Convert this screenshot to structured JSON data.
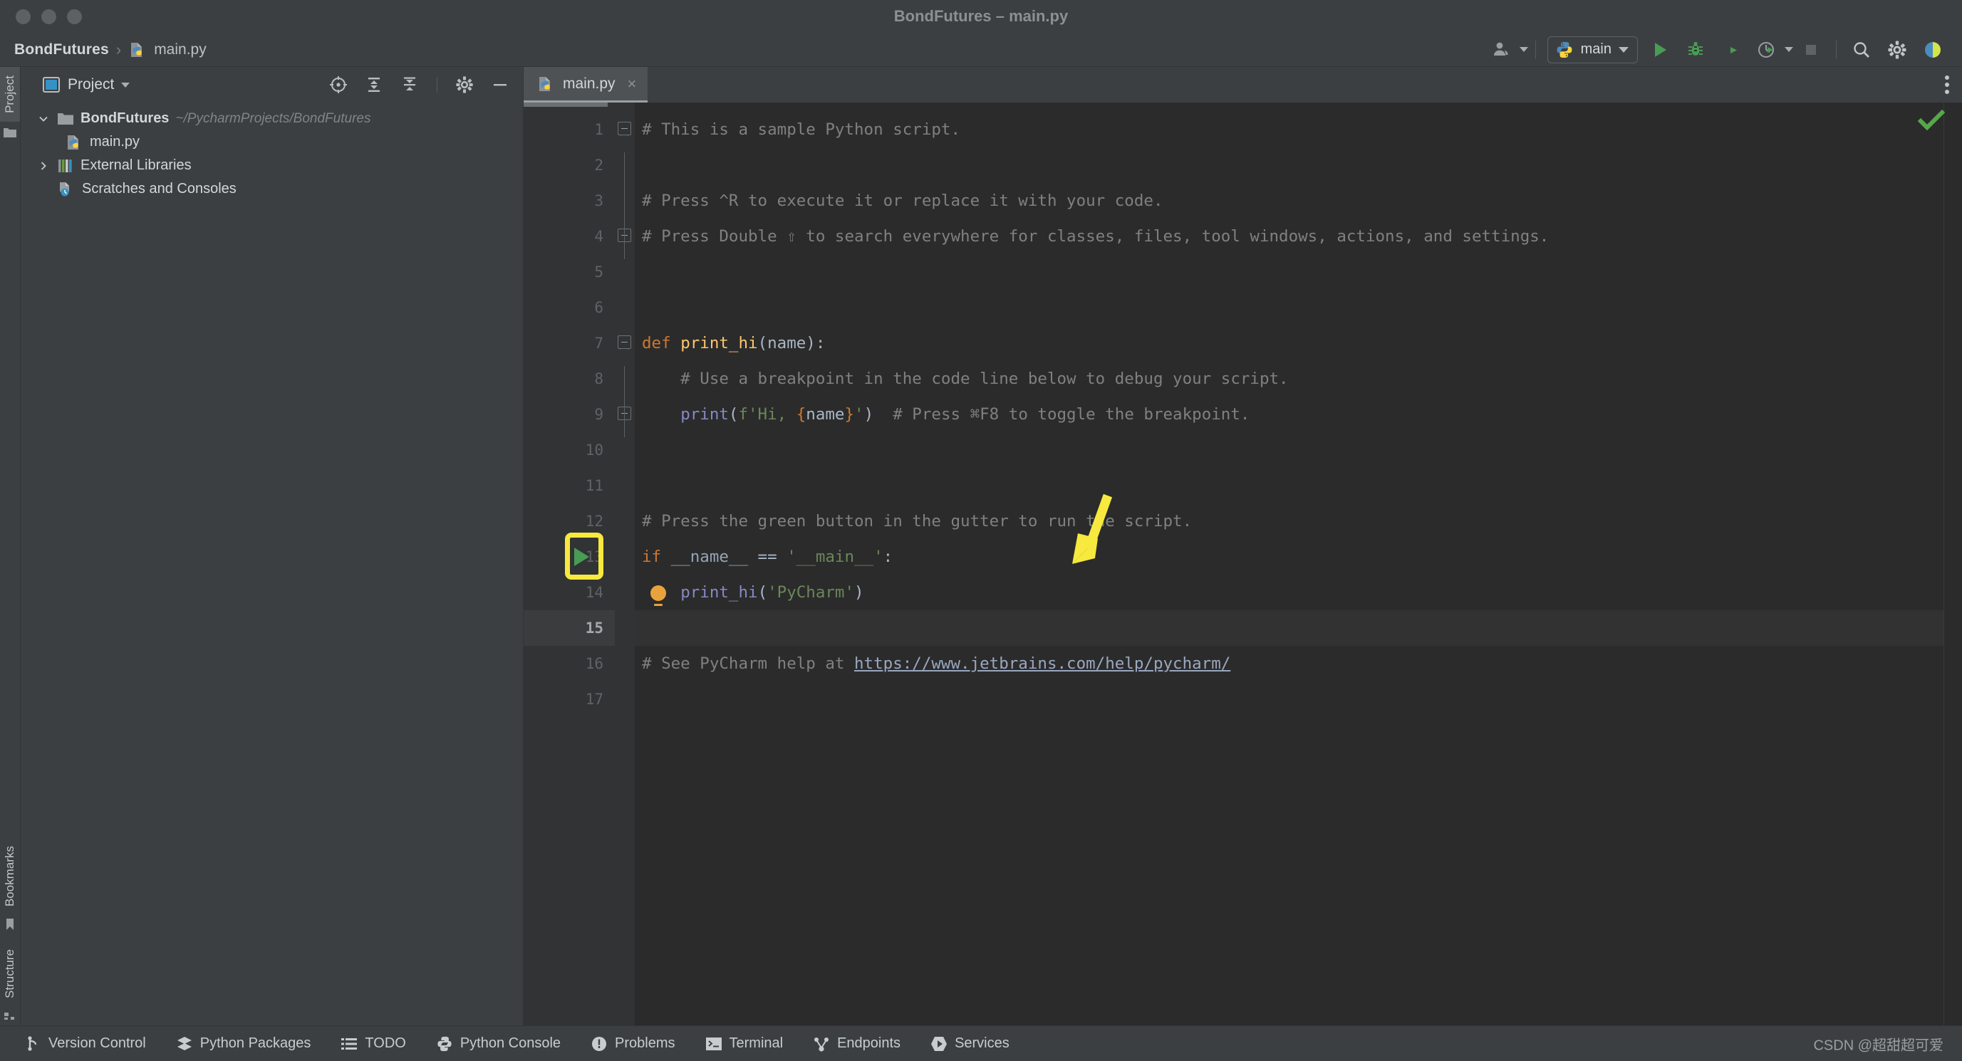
{
  "window": {
    "title": "BondFutures – main.py",
    "traffic_lights": [
      "close",
      "minimize",
      "zoom"
    ]
  },
  "toolbar": {
    "breadcrumb": {
      "project": "BondFutures",
      "separator": "›",
      "file": "main.py"
    },
    "account_icon": "user-account-icon",
    "run_config": {
      "label": "main",
      "icon": "python-icon"
    },
    "actions": [
      {
        "name": "run-button",
        "icon": "play-icon",
        "color": "#499c54"
      },
      {
        "name": "debug-button",
        "icon": "bug-icon",
        "color": "#499c54"
      },
      {
        "name": "run-with-coverage-button",
        "icon": "coverage-icon"
      },
      {
        "name": "profile-button",
        "icon": "profiler-icon"
      },
      {
        "name": "stop-button",
        "icon": "stop-icon"
      },
      {
        "name": "search-everywhere-button",
        "icon": "search-icon"
      },
      {
        "name": "settings-button",
        "icon": "gear-icon"
      }
    ]
  },
  "left_strip": {
    "tabs": [
      {
        "label": "Project",
        "icon": "folder-icon",
        "selected": true
      },
      {
        "label": "Bookmarks",
        "icon": "bookmark-icon",
        "selected": false
      },
      {
        "label": "Structure",
        "icon": "structure-icon",
        "selected": false
      }
    ]
  },
  "project_panel": {
    "title": "Project",
    "header_icons": [
      "locate-target-icon",
      "expand-all-icon",
      "collapse-all-icon",
      "gear-icon",
      "minimize-icon"
    ],
    "tree": [
      {
        "label": "BondFutures",
        "path": "~/PycharmProjects/BondFutures",
        "icon": "folder-icon",
        "expanded": true,
        "depth": 0,
        "bold": true
      },
      {
        "label": "main.py",
        "path": "",
        "icon": "python-file-icon",
        "expanded": null,
        "depth": 1,
        "bold": false
      },
      {
        "label": "External Libraries",
        "path": "",
        "icon": "libraries-icon",
        "expanded": false,
        "depth": 0,
        "bold": false
      },
      {
        "label": "Scratches and Consoles",
        "path": "",
        "icon": "scratches-icon",
        "expanded": null,
        "depth": 0,
        "bold": false
      }
    ]
  },
  "editor": {
    "tabs": [
      {
        "label": "main.py",
        "icon": "python-file-icon",
        "close": "×",
        "active": true
      }
    ],
    "inspection_status": "ok-checkmark",
    "current_line": 15,
    "lines": [
      {
        "n": 1,
        "fold": "start",
        "tokens": [
          {
            "t": "# This is a sample Python script.",
            "c": "c-com"
          }
        ]
      },
      {
        "n": 2,
        "fold": "stem",
        "tokens": []
      },
      {
        "n": 3,
        "fold": "stem",
        "tokens": [
          {
            "t": "# Press ^R to execute it or replace it with your code.",
            "c": "c-com"
          }
        ]
      },
      {
        "n": 4,
        "fold": "end",
        "tokens": [
          {
            "t": "# Press Double ⇧ to search everywhere for classes, files, tool windows, actions, and settings.",
            "c": "c-com"
          }
        ]
      },
      {
        "n": 5,
        "fold": "",
        "tokens": []
      },
      {
        "n": 6,
        "fold": "",
        "tokens": []
      },
      {
        "n": 7,
        "fold": "start",
        "tokens": [
          {
            "t": "def ",
            "c": "c-kw"
          },
          {
            "t": "print_hi",
            "c": "c-fn"
          },
          {
            "t": "(",
            "c": "c-par"
          },
          {
            "t": "name",
            "c": "c-id"
          },
          {
            "t": "):",
            "c": "c-par"
          }
        ]
      },
      {
        "n": 8,
        "fold": "stem",
        "tokens": [
          {
            "t": "    # Use a breakpoint in the code line below to debug your script.",
            "c": "c-com"
          }
        ]
      },
      {
        "n": 9,
        "fold": "end",
        "tokens": [
          {
            "t": "    ",
            "c": "c-id"
          },
          {
            "t": "print",
            "c": "c-call"
          },
          {
            "t": "(",
            "c": "c-par"
          },
          {
            "t": "f'Hi, ",
            "c": "c-str"
          },
          {
            "t": "{",
            "c": "c-brc"
          },
          {
            "t": "name",
            "c": "c-id"
          },
          {
            "t": "}",
            "c": "c-brc"
          },
          {
            "t": "'",
            "c": "c-str"
          },
          {
            "t": ")",
            "c": "c-par"
          },
          {
            "t": "  # Press ⌘F8 to toggle the breakpoint.",
            "c": "c-com"
          }
        ]
      },
      {
        "n": 10,
        "fold": "",
        "tokens": []
      },
      {
        "n": 11,
        "fold": "",
        "tokens": []
      },
      {
        "n": 12,
        "fold": "",
        "tokens": [
          {
            "t": "# Press the green button in the gutter to run the script.",
            "c": "c-com"
          }
        ]
      },
      {
        "n": 13,
        "fold": "",
        "tokens": [
          {
            "t": "if ",
            "c": "c-kw"
          },
          {
            "t": "__name__",
            "c": "c-dunder"
          },
          {
            "t": " == ",
            "c": "c-par"
          },
          {
            "t": "'__main__'",
            "c": "c-str"
          },
          {
            "t": ":",
            "c": "c-par"
          }
        ]
      },
      {
        "n": 14,
        "fold": "",
        "tokens": [
          {
            "t": "    ",
            "c": "c-id"
          },
          {
            "t": "print_hi",
            "c": "c-call"
          },
          {
            "t": "(",
            "c": "c-par"
          },
          {
            "t": "'PyCharm'",
            "c": "c-str"
          },
          {
            "t": ")",
            "c": "c-par"
          }
        ]
      },
      {
        "n": 15,
        "fold": "",
        "tokens": []
      },
      {
        "n": 16,
        "fold": "",
        "tokens": [
          {
            "t": "# See PyCharm help at ",
            "c": "c-com"
          },
          {
            "t": "https://www.jetbrains.com/help/pycharm/",
            "c": "c-url"
          }
        ]
      },
      {
        "n": 17,
        "fold": "",
        "tokens": []
      }
    ],
    "gutter_run_button": {
      "line": 13,
      "icon": "play-icon",
      "color": "#499c54",
      "annotated": true
    },
    "intention_bulb": {
      "line": 14,
      "icon": "lightbulb-icon",
      "color": "#e8a33d"
    }
  },
  "annotation": {
    "color": "#f7e93e",
    "arrow": "down-arrow-annotation",
    "highlight_box": "run-button-highlight-box"
  },
  "status_bar": {
    "items": [
      {
        "label": "Version Control",
        "icon": "branch-icon"
      },
      {
        "label": "Python Packages",
        "icon": "packages-icon"
      },
      {
        "label": "TODO",
        "icon": "todo-list-icon"
      },
      {
        "label": "Python Console",
        "icon": "python-icon"
      },
      {
        "label": "Problems",
        "icon": "problems-icon"
      },
      {
        "label": "Terminal",
        "icon": "terminal-icon"
      },
      {
        "label": "Endpoints",
        "icon": "endpoints-icon"
      },
      {
        "label": "Services",
        "icon": "services-icon"
      }
    ],
    "watermark": "CSDN @超甜超可爱"
  },
  "colors": {
    "accent_green": "#499c54",
    "annotation_yellow": "#f7e93e",
    "editor_bg": "#2b2b2b",
    "panel_bg": "#3c3f41",
    "gutter_bg": "#313335"
  }
}
